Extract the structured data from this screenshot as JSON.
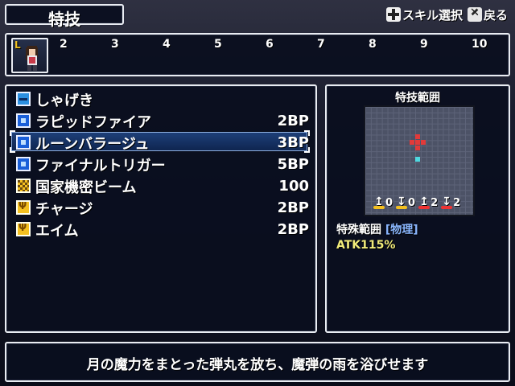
{
  "header": {
    "title": "特技",
    "hint_select": "スキル選択",
    "hint_back": "戻る"
  },
  "party": {
    "slot1_badge": "L",
    "slots": [
      "2",
      "3",
      "4",
      "5",
      "6",
      "7",
      "8",
      "9",
      "10"
    ]
  },
  "skills": [
    {
      "name": "しゃげき",
      "cost": "",
      "icon": "gun-icon"
    },
    {
      "name": "ラピッドファイア",
      "cost": "2BP",
      "icon": "skill-icon"
    },
    {
      "name": "ルーンバラージュ",
      "cost": "3BP",
      "icon": "skill-icon",
      "selected": true
    },
    {
      "name": "ファイナルトリガー",
      "cost": "5BP",
      "icon": "skill-icon"
    },
    {
      "name": "国家機密ビーム",
      "cost": "100",
      "icon": "special-icon"
    },
    {
      "name": "チャージ",
      "cost": "2BP",
      "icon": "buff-icon"
    },
    {
      "name": "エイム",
      "cost": "2BP",
      "icon": "buff-icon"
    }
  ],
  "info": {
    "range_title": "特技範囲",
    "stats": [
      {
        "icon": "arrow-up-yellow-icon",
        "value": "0"
      },
      {
        "icon": "arrow-down-yellow-icon",
        "value": "0"
      },
      {
        "icon": "arrow-up-red-icon",
        "value": "2"
      },
      {
        "icon": "arrow-down-red-icon",
        "value": "2"
      }
    ],
    "special_label": "特殊範囲",
    "special_type": "[物理]",
    "atk": "ATK115%"
  },
  "description": "月の魔力をまとった弾丸を放ち、魔弾の雨を浴びせます",
  "colors": {
    "panel_border": "#e9ecf2",
    "panel_bg": "#0a0e1e",
    "selection": "#1d3f78",
    "range_red": "#e23a3a",
    "range_cyan": "#4fd8e0",
    "atk": "#f2ec7a"
  }
}
